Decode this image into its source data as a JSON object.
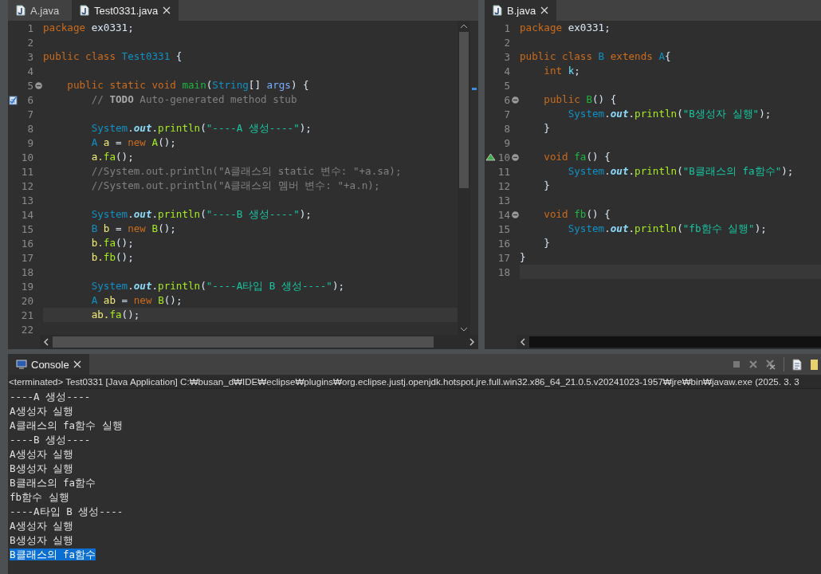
{
  "editors": [
    {
      "tabs": [
        {
          "label": "A.java",
          "selected": false
        },
        {
          "label": "Test0331.java",
          "selected": true
        }
      ],
      "vertical_scrollbar": true,
      "lines": [
        {
          "number": "1",
          "tokens": [
            {
              "kind": "kw",
              "text": "package"
            },
            {
              "kind": "pl",
              "text": " ex0331;"
            }
          ]
        },
        {
          "number": "2"
        },
        {
          "number": "3",
          "tokens": [
            {
              "kind": "kw",
              "text": "public class "
            },
            {
              "kind": "type",
              "text": "Test0331"
            },
            {
              "kind": "pl",
              "text": " {"
            }
          ]
        },
        {
          "number": "4"
        },
        {
          "number": "5",
          "foldable": true,
          "tokens": [
            {
              "kind": "kw",
              "text": "    public static void "
            },
            {
              "kind": "method",
              "text": "main"
            },
            {
              "kind": "pl",
              "text": "("
            },
            {
              "kind": "type",
              "text": "String"
            },
            {
              "kind": "pl",
              "text": "[] "
            },
            {
              "kind": "param",
              "text": "args"
            },
            {
              "kind": "pl",
              "text": ") {"
            }
          ]
        },
        {
          "number": "6",
          "task": true,
          "tokens": [
            {
              "kind": "comment",
              "text": "        // "
            },
            {
              "kind": "todo",
              "text": "TODO"
            },
            {
              "kind": "comment",
              "text": " Auto-generated method stub"
            }
          ]
        },
        {
          "number": "7"
        },
        {
          "number": "8",
          "tokens": [
            {
              "kind": "type",
              "text": "        System"
            },
            {
              "kind": "pl",
              "text": "."
            },
            {
              "kind": "field",
              "text": "out"
            },
            {
              "kind": "pl",
              "text": "."
            },
            {
              "kind": "call",
              "text": "println"
            },
            {
              "kind": "pl",
              "text": "("
            },
            {
              "kind": "str",
              "text": "\"----A 생성----\""
            },
            {
              "kind": "pl",
              "text": ");"
            }
          ]
        },
        {
          "number": "9",
          "tokens": [
            {
              "kind": "type",
              "text": "        A "
            },
            {
              "kind": "var",
              "text": "a"
            },
            {
              "kind": "pl",
              "text": " = "
            },
            {
              "kind": "kw",
              "text": "new "
            },
            {
              "kind": "call",
              "text": "A"
            },
            {
              "kind": "pl",
              "text": "();"
            }
          ]
        },
        {
          "number": "10",
          "tokens": [
            {
              "kind": "var",
              "text": "        a."
            },
            {
              "kind": "call",
              "text": "fa"
            },
            {
              "kind": "pl",
              "text": "();"
            }
          ]
        },
        {
          "number": "11",
          "tokens": [
            {
              "kind": "comment",
              "text": "        //System.out.println(\"A클래스의 static 변수: \"+a.sa);"
            }
          ]
        },
        {
          "number": "12",
          "tokens": [
            {
              "kind": "comment",
              "text": "        //System.out.println(\"A클래스의 멤버 변수: \"+a.n);"
            }
          ]
        },
        {
          "number": "13"
        },
        {
          "number": "14",
          "tokens": [
            {
              "kind": "type",
              "text": "        System"
            },
            {
              "kind": "pl",
              "text": "."
            },
            {
              "kind": "field",
              "text": "out"
            },
            {
              "kind": "pl",
              "text": "."
            },
            {
              "kind": "call",
              "text": "println"
            },
            {
              "kind": "pl",
              "text": "("
            },
            {
              "kind": "str",
              "text": "\"----B 생성----\""
            },
            {
              "kind": "pl",
              "text": ");"
            }
          ]
        },
        {
          "number": "15",
          "tokens": [
            {
              "kind": "type",
              "text": "        B "
            },
            {
              "kind": "var",
              "text": "b"
            },
            {
              "kind": "pl",
              "text": " = "
            },
            {
              "kind": "kw",
              "text": "new "
            },
            {
              "kind": "call",
              "text": "B"
            },
            {
              "kind": "pl",
              "text": "();"
            }
          ]
        },
        {
          "number": "16",
          "tokens": [
            {
              "kind": "var",
              "text": "        b."
            },
            {
              "kind": "call",
              "text": "fa"
            },
            {
              "kind": "pl",
              "text": "();"
            }
          ]
        },
        {
          "number": "17",
          "tokens": [
            {
              "kind": "var",
              "text": "        b."
            },
            {
              "kind": "call",
              "text": "fb"
            },
            {
              "kind": "pl",
              "text": "();"
            }
          ]
        },
        {
          "number": "18"
        },
        {
          "number": "19",
          "tokens": [
            {
              "kind": "type",
              "text": "        System"
            },
            {
              "kind": "pl",
              "text": "."
            },
            {
              "kind": "field",
              "text": "out"
            },
            {
              "kind": "pl",
              "text": "."
            },
            {
              "kind": "call",
              "text": "println"
            },
            {
              "kind": "pl",
              "text": "("
            },
            {
              "kind": "str",
              "text": "\"----A타입 B 생성----\""
            },
            {
              "kind": "pl",
              "text": ");"
            }
          ]
        },
        {
          "number": "20",
          "tokens": [
            {
              "kind": "type",
              "text": "        A "
            },
            {
              "kind": "var",
              "text": "ab"
            },
            {
              "kind": "pl",
              "text": " = "
            },
            {
              "kind": "kw",
              "text": "new "
            },
            {
              "kind": "call",
              "text": "B"
            },
            {
              "kind": "pl",
              "text": "();"
            }
          ]
        },
        {
          "number": "21",
          "current": true,
          "tokens": [
            {
              "kind": "var",
              "text": "        ab."
            },
            {
              "kind": "call",
              "text": "fa"
            },
            {
              "kind": "pl",
              "text": "();"
            }
          ]
        },
        {
          "number": "22"
        }
      ]
    },
    {
      "tabs": [
        {
          "label": "B.java",
          "selected": true
        }
      ],
      "lines": [
        {
          "number": "1",
          "tokens": [
            {
              "kind": "kw",
              "text": "package"
            },
            {
              "kind": "pl",
              "text": " ex0331;"
            }
          ]
        },
        {
          "number": "2"
        },
        {
          "number": "3",
          "tokens": [
            {
              "kind": "kw",
              "text": "public class "
            },
            {
              "kind": "type",
              "text": "B"
            },
            {
              "kind": "kw",
              "text": " extends "
            },
            {
              "kind": "type",
              "text": "A"
            },
            {
              "kind": "pl",
              "text": "{"
            }
          ]
        },
        {
          "number": "4",
          "tokens": [
            {
              "kind": "kw",
              "text": "    int "
            },
            {
              "kind": "member",
              "text": "k"
            },
            {
              "kind": "pl",
              "text": ";"
            }
          ]
        },
        {
          "number": "5"
        },
        {
          "number": "6",
          "foldable": true,
          "tokens": [
            {
              "kind": "kw",
              "text": "    public "
            },
            {
              "kind": "method",
              "text": "B"
            },
            {
              "kind": "pl",
              "text": "() {"
            }
          ]
        },
        {
          "number": "7",
          "tokens": [
            {
              "kind": "type",
              "text": "        System"
            },
            {
              "kind": "pl",
              "text": "."
            },
            {
              "kind": "field",
              "text": "out"
            },
            {
              "kind": "pl",
              "text": "."
            },
            {
              "kind": "call",
              "text": "println"
            },
            {
              "kind": "pl",
              "text": "("
            },
            {
              "kind": "str",
              "text": "\"B생성자 실행\""
            },
            {
              "kind": "pl",
              "text": ");"
            }
          ]
        },
        {
          "number": "8",
          "tokens": [
            {
              "kind": "pl",
              "text": "    }"
            }
          ]
        },
        {
          "number": "9"
        },
        {
          "number": "10",
          "foldable": true,
          "override": true,
          "tokens": [
            {
              "kind": "kw",
              "text": "    void "
            },
            {
              "kind": "method",
              "text": "fa"
            },
            {
              "kind": "pl",
              "text": "() {"
            }
          ]
        },
        {
          "number": "11",
          "tokens": [
            {
              "kind": "type",
              "text": "        System"
            },
            {
              "kind": "pl",
              "text": "."
            },
            {
              "kind": "field",
              "text": "out"
            },
            {
              "kind": "pl",
              "text": "."
            },
            {
              "kind": "call",
              "text": "println"
            },
            {
              "kind": "pl",
              "text": "("
            },
            {
              "kind": "str",
              "text": "\"B클래스의 fa함수\""
            },
            {
              "kind": "pl",
              "text": ");"
            }
          ]
        },
        {
          "number": "12",
          "tokens": [
            {
              "kind": "pl",
              "text": "    }"
            }
          ]
        },
        {
          "number": "13"
        },
        {
          "number": "14",
          "foldable": true,
          "tokens": [
            {
              "kind": "kw",
              "text": "    void "
            },
            {
              "kind": "method",
              "text": "fb"
            },
            {
              "kind": "pl",
              "text": "() {"
            }
          ]
        },
        {
          "number": "15",
          "tokens": [
            {
              "kind": "type",
              "text": "        System"
            },
            {
              "kind": "pl",
              "text": "."
            },
            {
              "kind": "field",
              "text": "out"
            },
            {
              "kind": "pl",
              "text": "."
            },
            {
              "kind": "call",
              "text": "println"
            },
            {
              "kind": "pl",
              "text": "("
            },
            {
              "kind": "str",
              "text": "\"fb함수 실행\""
            },
            {
              "kind": "pl",
              "text": ");"
            }
          ]
        },
        {
          "number": "16",
          "tokens": [
            {
              "kind": "pl",
              "text": "    }"
            }
          ]
        },
        {
          "number": "17",
          "tokens": [
            {
              "kind": "pl",
              "text": "}"
            }
          ]
        },
        {
          "number": "18",
          "current": true
        }
      ]
    }
  ],
  "console": {
    "tab": {
      "label": "Console",
      "selected": true
    },
    "info": "<terminated> Test0331 [Java Application] C:₩busan_d₩IDE₩eclipse₩plugins₩org.eclipse.justj.openjdk.hotspot.jre.full.win32.x86_64_21.0.5.v20241023-1957₩jre₩bin₩javaw.exe  (2025. 3. 3",
    "output": [
      {
        "text": "----A 생성----",
        "selected": false
      },
      {
        "text": "A생성자 실행",
        "selected": false
      },
      {
        "text": "A클래스의 fa함수 실행",
        "selected": false
      },
      {
        "text": "----B 생성----",
        "selected": false
      },
      {
        "text": "A생성자 실행",
        "selected": false
      },
      {
        "text": "B생성자 실행",
        "selected": false
      },
      {
        "text": "B클래스의 fa함수",
        "selected": false
      },
      {
        "text": "fb함수 실행",
        "selected": false
      },
      {
        "text": "----A타입 B 생성----",
        "selected": false
      },
      {
        "text": "A생성자 실행",
        "selected": false
      },
      {
        "text": "B생성자 실행",
        "selected": false
      },
      {
        "text": "B클래스의 fa함수",
        "selected": true
      }
    ]
  }
}
